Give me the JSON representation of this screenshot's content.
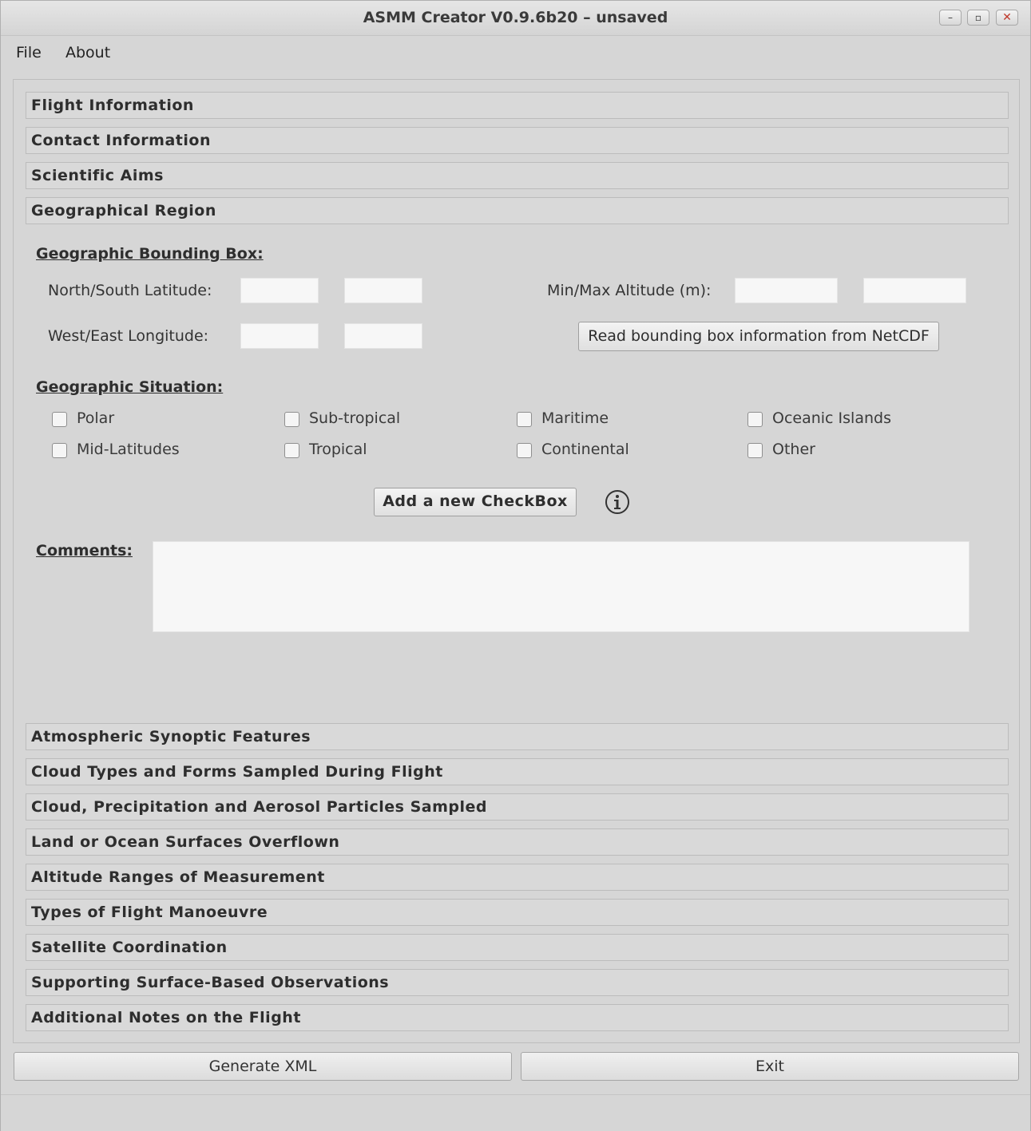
{
  "window": {
    "title": "ASMM Creator V0.9.6b20 – unsaved",
    "min_glyph": "–",
    "max_glyph": "▫",
    "close_glyph": "✕"
  },
  "menu": {
    "file": "File",
    "about": "About"
  },
  "sections_top": [
    "Flight Information",
    "Contact Information",
    "Scientific Aims",
    "Geographical Region"
  ],
  "geo": {
    "bounding_box_title": "Geographic Bounding Box:",
    "ns_lat_label": "North/South Latitude:",
    "we_lon_label": "West/East Longitude:",
    "alt_label": "Min/Max Altitude (m):",
    "read_netcdf_button": "Read bounding box information from NetCDF",
    "situation_title": "Geographic Situation:",
    "checkboxes": [
      {
        "label": "Polar",
        "checked": false
      },
      {
        "label": "Sub-tropical",
        "checked": false
      },
      {
        "label": "Maritime",
        "checked": false
      },
      {
        "label": "Oceanic Islands",
        "checked": false
      },
      {
        "label": "Mid-Latitudes",
        "checked": false
      },
      {
        "label": "Tropical",
        "checked": false
      },
      {
        "label": "Continental",
        "checked": false
      },
      {
        "label": "Other",
        "checked": false
      }
    ],
    "add_checkbox_button": "Add a new CheckBox",
    "comments_label": "Comments:"
  },
  "sections_bottom": [
    "Atmospheric Synoptic Features",
    "Cloud Types and Forms Sampled During Flight",
    "Cloud, Precipitation and Aerosol Particles Sampled",
    "Land or Ocean Surfaces Overflown",
    "Altitude Ranges of Measurement",
    "Types of Flight Manoeuvre",
    "Satellite Coordination",
    "Supporting Surface-Based Observations",
    "Additional Notes on the Flight"
  ],
  "buttons": {
    "generate_xml": "Generate XML",
    "exit": "Exit"
  }
}
